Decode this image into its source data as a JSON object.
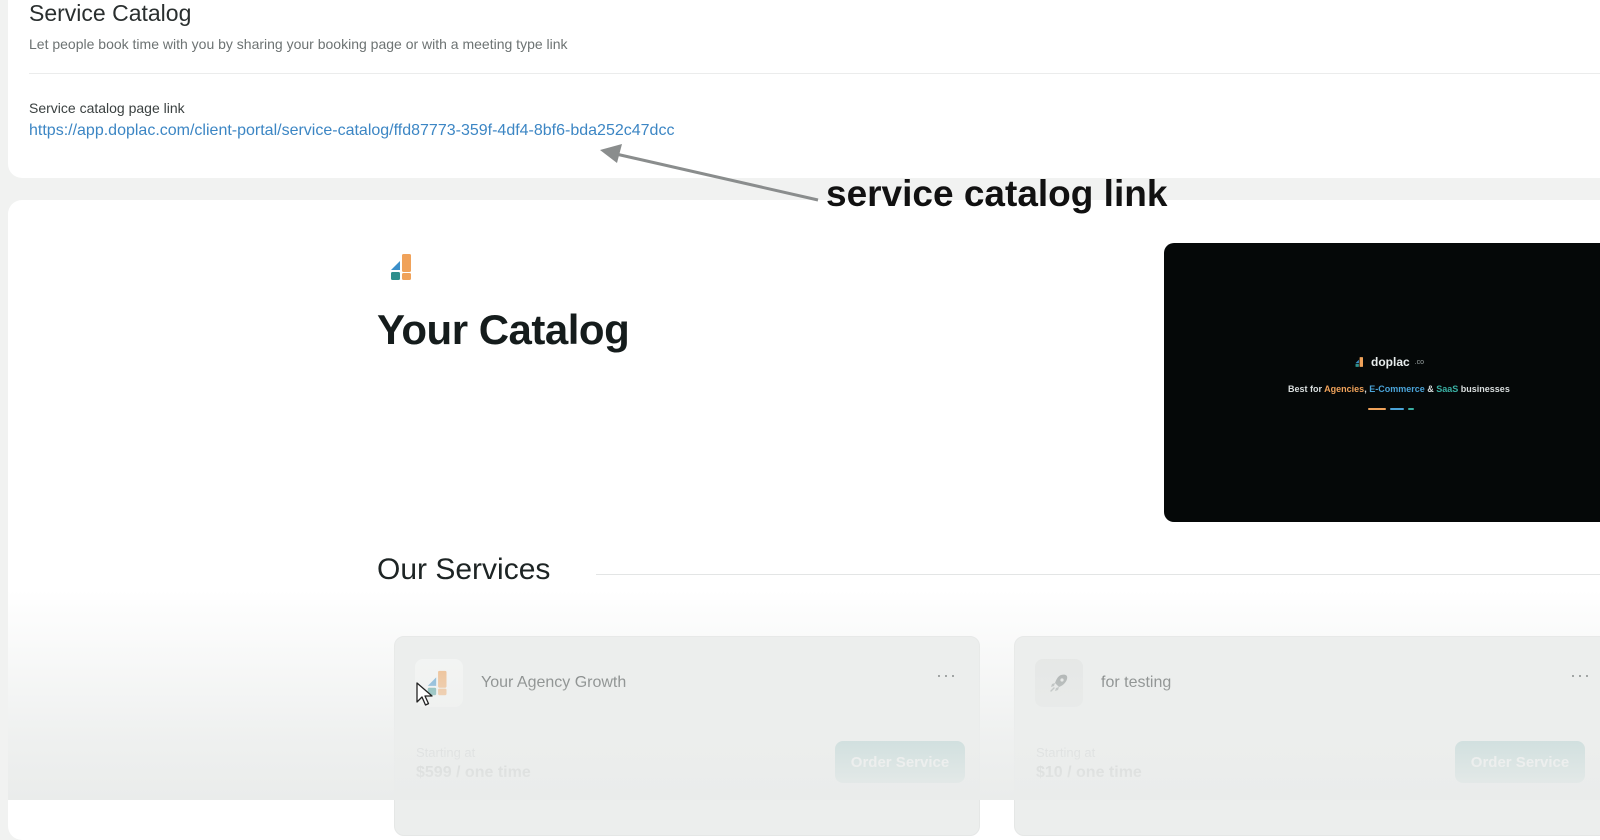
{
  "header": {
    "title": "Service Catalog",
    "subtitle": "Let people book time with you by sharing your booking page or with a meeting type link",
    "link_label": "Service catalog page link",
    "link_url": "https://app.doplac.com/client-portal/service-catalog/ffd87773-359f-4df4-8bf6-bda252c47dcc"
  },
  "annotation": {
    "text": "service catalog link",
    "arrow_icon": "arrow-left-up-icon"
  },
  "catalog": {
    "logo_icon": "doplac-logo-icon",
    "title": "Your Catalog",
    "video": {
      "brand": "doplac",
      "brand_suffix": ".co",
      "tagline_prefix": "Best for ",
      "tagline_agencies": "Agencies",
      "tagline_sep": ", ",
      "tagline_ecommerce": "E-Commerce",
      "tagline_and": " & ",
      "tagline_saas": "SaaS",
      "tagline_suffix": " businesses"
    }
  },
  "services": {
    "section_title": "Our Services",
    "items": [
      {
        "name": "Your Agency Growth",
        "price_label": "Starting at",
        "price": "$599 / one time",
        "button": "Order Service",
        "more": "···",
        "icon": "doplac-logo-icon"
      },
      {
        "name": "for testing",
        "price_label": "Starting at",
        "price": "$10 / one time",
        "button": "Order Service",
        "more": "···",
        "icon": "rocket-icon"
      }
    ]
  },
  "colors": {
    "accent": "#2c8a88",
    "link": "#3c86c4",
    "logo_blue": "#3a8fc9",
    "logo_orange": "#f0a25a",
    "logo_teal": "#2f8f8c"
  }
}
